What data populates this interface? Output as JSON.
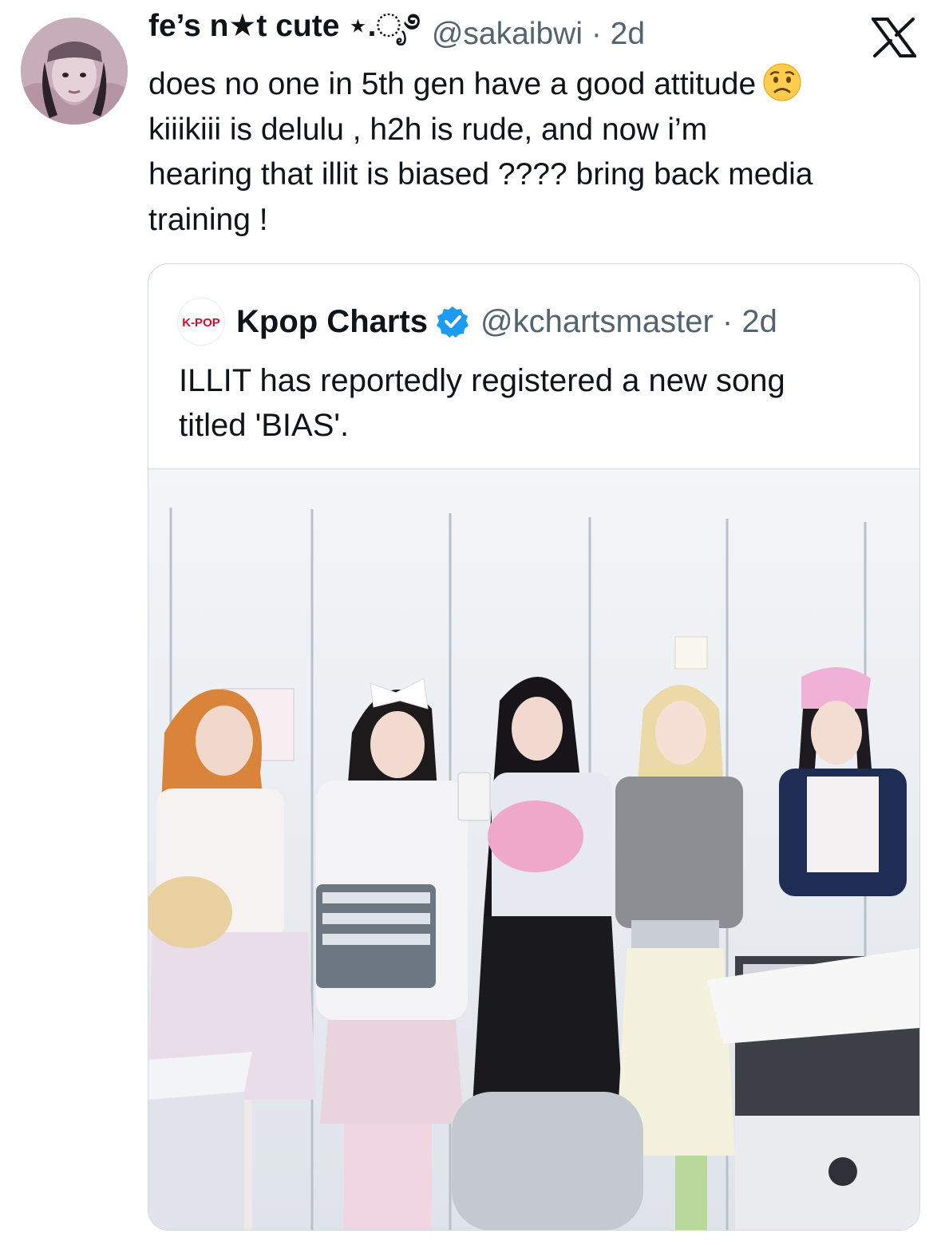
{
  "tweet": {
    "display_name": "fe’s n★t cute ⋆.ೃ࿔",
    "handle_meta": "@sakaibwi · 2d",
    "text_lines": [
      "does no one in 5th gen have a good attitude",
      "kiiikiii is delulu , h2h is rude, and now i’m",
      "hearing that illit is biased ???? bring back media",
      "training !"
    ],
    "emoji": "worried-face"
  },
  "quoted_tweet": {
    "avatar_label": "K-POP",
    "display_name": "Kpop Charts",
    "handle_meta": "@kchartsmaster · 2d",
    "text_lines": [
      "ILLIT has reportedly registered a new song",
      "titled 'BIAS'."
    ],
    "verified": true
  },
  "media": {
    "description_icon": "group-photo-image"
  },
  "brand": {
    "logo": "x-logo-icon",
    "verified_color": "#1d9bf0",
    "secondary_text_color": "#536471"
  }
}
